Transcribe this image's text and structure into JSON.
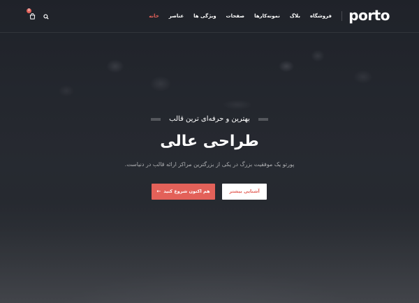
{
  "header": {
    "logo": "porto",
    "nav": [
      {
        "label": "خانه",
        "active": true
      },
      {
        "label": "عناصر",
        "active": false
      },
      {
        "label": "ویژگی ها",
        "active": false
      },
      {
        "label": "صفحات",
        "active": false
      },
      {
        "label": "نمونه‌کارها",
        "active": false
      },
      {
        "label": "بلاگ",
        "active": false
      },
      {
        "label": "فروشگاه",
        "active": false
      }
    ],
    "icons": [
      "search-icon",
      "cart-icon"
    ],
    "cart_count": "0"
  },
  "hero": {
    "subheading": "بهترین و حرفه‌ای ترین قالب",
    "title": "طراحی عالی",
    "description": "پورتو یک موفقیت بزرگ در یکی از بزرگترین مراکز ارائه قالب در دنیاست.",
    "primary_button": "هم اکنون شروع کنید",
    "secondary_button": "آشنایی بیشتر"
  },
  "colors": {
    "accent": "#e36159",
    "text": "#ffffff"
  }
}
